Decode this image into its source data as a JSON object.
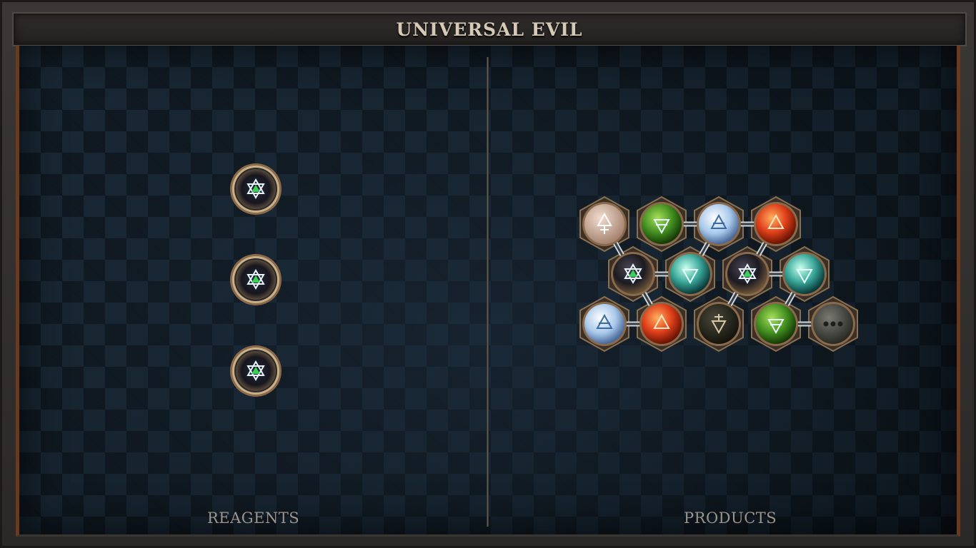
{
  "title": "UNIVERSAL EVIL",
  "reagents": {
    "label": "REAGENTS",
    "items": [
      {
        "symbol": "salt-star-icon"
      },
      {
        "symbol": "salt-star-icon"
      },
      {
        "symbol": "salt-star-icon"
      }
    ]
  },
  "products": {
    "label": "PRODUCTS",
    "marbles": [
      {
        "symbol": "quintessence-icon",
        "color": "#d8b6a0"
      },
      {
        "symbol": "earth-icon",
        "color": "#4f9a2a"
      },
      {
        "symbol": "air-icon",
        "color": "#b8d8f0"
      },
      {
        "symbol": "fire-icon",
        "color": "#e0521a"
      },
      {
        "symbol": "salt-star-icon",
        "color": "#3a3a3a"
      },
      {
        "symbol": "water-icon",
        "color": "#3ab0a0"
      },
      {
        "symbol": "salt-star-icon",
        "color": "#3a3a3a"
      },
      {
        "symbol": "water-icon",
        "color": "#3ab0a0"
      },
      {
        "symbol": "air-icon",
        "color": "#b8d8f0"
      },
      {
        "symbol": "fire-icon",
        "color": "#e0521a"
      },
      {
        "symbol": "lead-icon",
        "color": "#2a2a22"
      },
      {
        "symbol": "earth-icon",
        "color": "#4f9a2a"
      },
      {
        "symbol": "more-icon",
        "color": "#4a4a44"
      }
    ]
  },
  "colors": {
    "accent_copper": "#6b3a1e",
    "title_text": "#d6c9b6",
    "label_text": "#9b958c"
  }
}
